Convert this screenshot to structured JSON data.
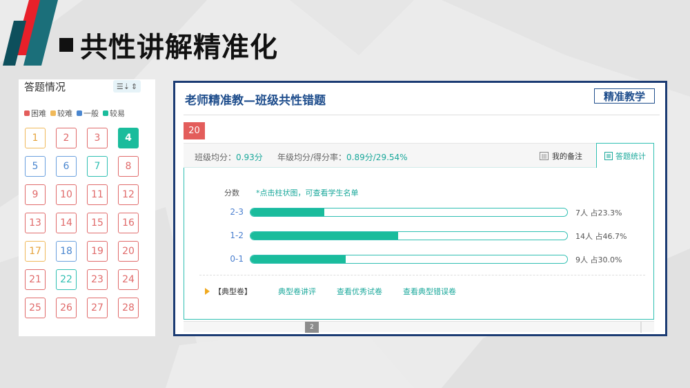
{
  "slide": {
    "title": "共性讲解精准化"
  },
  "colors": {
    "hard": "#e35d5b",
    "harder": "#f0b95a",
    "normal": "#4a86cf",
    "easy": "#1abc9c",
    "brand": "#1e4d8c"
  },
  "answer_panel": {
    "heading": "答题情况",
    "sort_icon": "sort-icon",
    "legend": [
      {
        "label": "困难",
        "color": "#e35d5b"
      },
      {
        "label": "较难",
        "color": "#f0b95a"
      },
      {
        "label": "一般",
        "color": "#4a86cf"
      },
      {
        "label": "较易",
        "color": "#1abc9c"
      }
    ],
    "questions": [
      {
        "num": "1",
        "level": "harder"
      },
      {
        "num": "2",
        "level": "hard"
      },
      {
        "num": "3",
        "level": "hard"
      },
      {
        "num": "4",
        "level": "active"
      },
      {
        "num": "5",
        "level": "normal"
      },
      {
        "num": "6",
        "level": "normal"
      },
      {
        "num": "7",
        "level": "easy"
      },
      {
        "num": "8",
        "level": "hard"
      },
      {
        "num": "9",
        "level": "hard"
      },
      {
        "num": "10",
        "level": "hard"
      },
      {
        "num": "11",
        "level": "hard"
      },
      {
        "num": "12",
        "level": "hard"
      },
      {
        "num": "13",
        "level": "hard"
      },
      {
        "num": "14",
        "level": "hard"
      },
      {
        "num": "15",
        "level": "hard"
      },
      {
        "num": "16",
        "level": "hard"
      },
      {
        "num": "17",
        "level": "harder"
      },
      {
        "num": "18",
        "level": "normal"
      },
      {
        "num": "19",
        "level": "hard"
      },
      {
        "num": "20",
        "level": "hard"
      },
      {
        "num": "21",
        "level": "hard"
      },
      {
        "num": "22",
        "level": "easy"
      },
      {
        "num": "23",
        "level": "hard"
      },
      {
        "num": "24",
        "level": "hard"
      },
      {
        "num": "25",
        "level": "hard"
      },
      {
        "num": "26",
        "level": "hard"
      },
      {
        "num": "27",
        "level": "hard"
      },
      {
        "num": "28",
        "level": "hard"
      }
    ]
  },
  "teaching_panel": {
    "title": "老师精准教—班级共性错题",
    "badge": "精准教学",
    "question_number": "20",
    "class_avg_label": "班级均分：",
    "class_avg_value": "0.93分",
    "grade_avg_label": "年级均分/得分率：",
    "grade_avg_value": "0.89分/29.54%",
    "tab_remark": "我的备注",
    "tab_stats": "答题统计",
    "score_label": "分数",
    "hint": "*点击柱状图，可查看学生名单",
    "typical_label": "【典型卷】",
    "links": [
      "典型卷讲评",
      "查看优秀试卷",
      "查看典型错误卷"
    ],
    "page_marker": "2"
  },
  "chart_data": {
    "type": "bar",
    "orientation": "horizontal",
    "categories": [
      "2-3",
      "1-2",
      "0-1"
    ],
    "values": [
      7,
      14,
      9
    ],
    "percents": [
      23.3,
      46.7,
      30.0
    ],
    "labels": [
      "7人 占23.3%",
      "14人 占46.7%",
      "9人 占30.0%"
    ],
    "ylabel": "分数"
  }
}
